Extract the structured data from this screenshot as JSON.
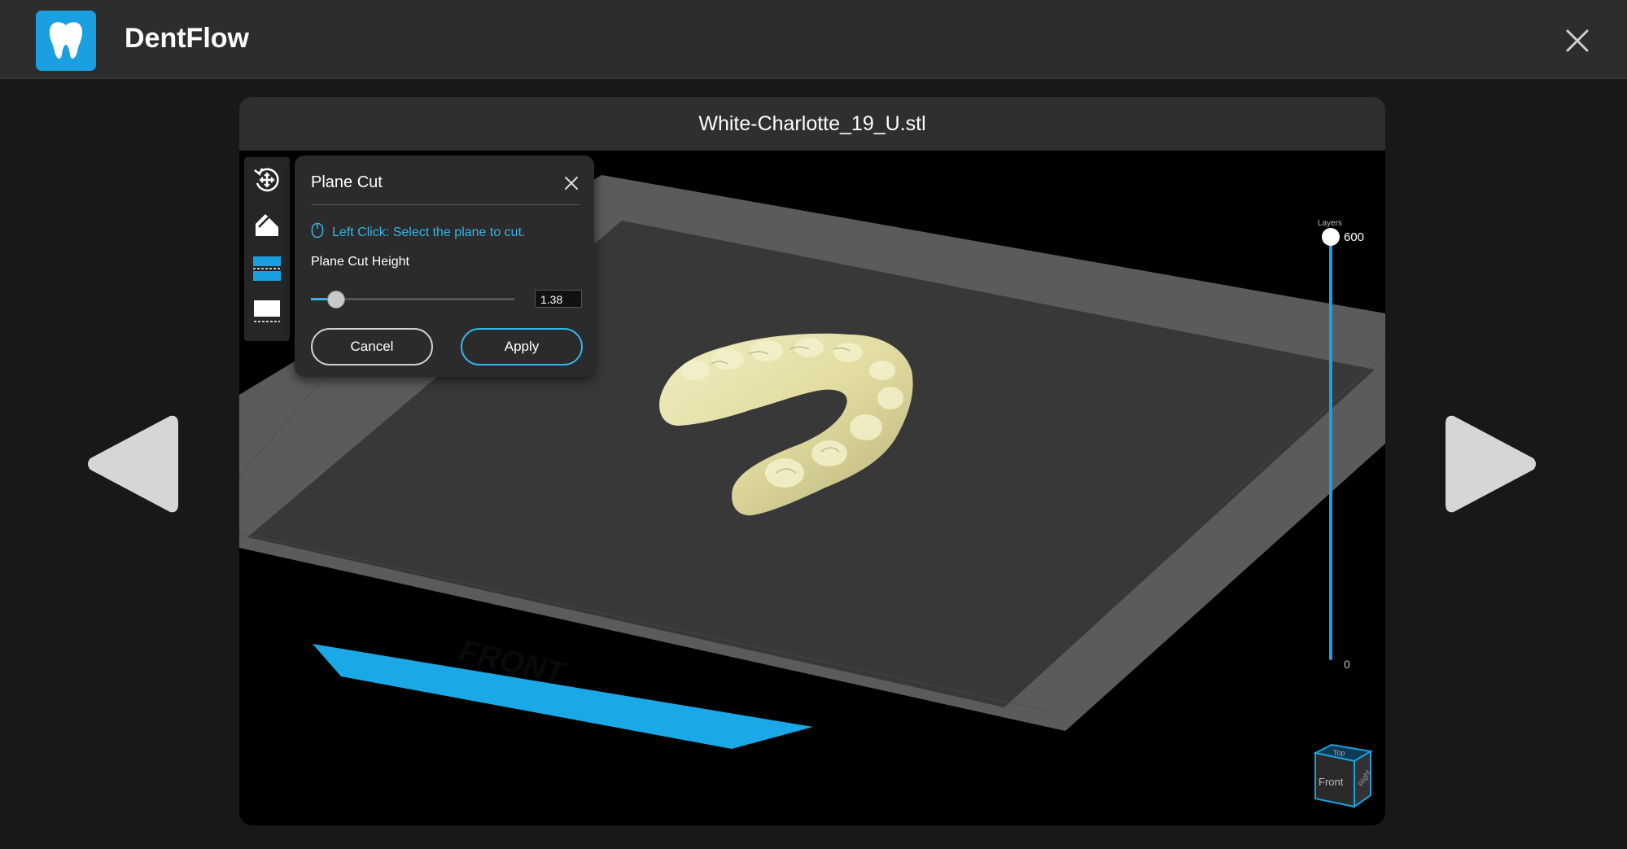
{
  "app": {
    "name": "DentFlow",
    "logo_icon": "tooth-icon",
    "brand_color": "#1aa0e0"
  },
  "viewer": {
    "file_name": "White-Charlotte_19_U.stl",
    "platform_label": "FRONT"
  },
  "toolbar": {
    "tools": [
      {
        "icon": "rotate-move-icon"
      },
      {
        "icon": "support-icon"
      },
      {
        "icon": "plane-cut-icon",
        "active": true
      },
      {
        "icon": "base-icon"
      }
    ]
  },
  "plane_cut": {
    "title": "Plane Cut",
    "hint": "Left Click: Select the plane to cut.",
    "height_label": "Plane Cut Height",
    "height_value": "1.38",
    "slider_fraction": 0.12,
    "cancel_label": "Cancel",
    "apply_label": "Apply"
  },
  "layers": {
    "title": "Layers",
    "max": "600",
    "min": "0",
    "current_fraction": 1.0
  },
  "view_cube": {
    "top": "Top",
    "front": "Front",
    "right": "Right"
  }
}
